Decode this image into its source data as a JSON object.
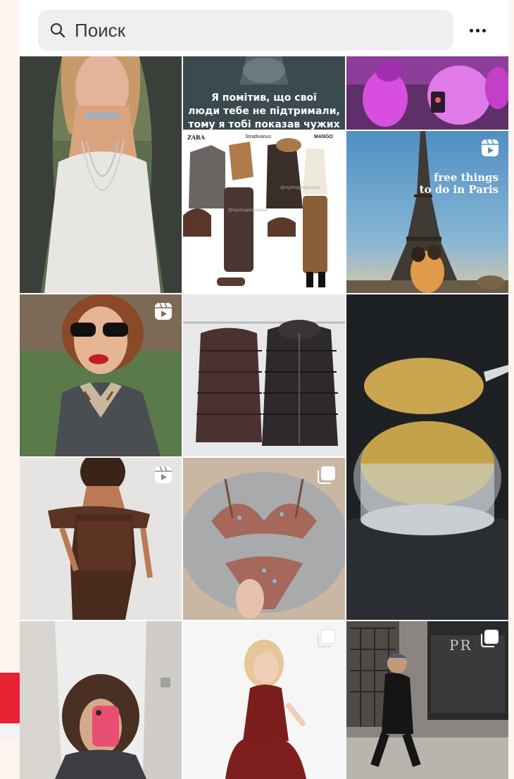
{
  "search": {
    "placeholder": "Поиск"
  },
  "tiles": {
    "text_post": {
      "line1": "Я помітив, що свої",
      "line2": "люди тебе не підтримали,",
      "line3": "тому я тобі показав чужих"
    },
    "outfit_collage": {
      "brand_left": "ZARA",
      "brand_mid": "Stradivarius",
      "brand_right": "MANGO",
      "watermark": "@myshoppingchoice"
    },
    "paris": {
      "line1": "free things",
      "line2": "to do in Paris"
    },
    "street": {
      "store_sign": "PR"
    }
  },
  "icons": {
    "reel": "reel-icon",
    "carousel": "carousel-icon",
    "more": "more-icon",
    "search": "search-icon"
  }
}
